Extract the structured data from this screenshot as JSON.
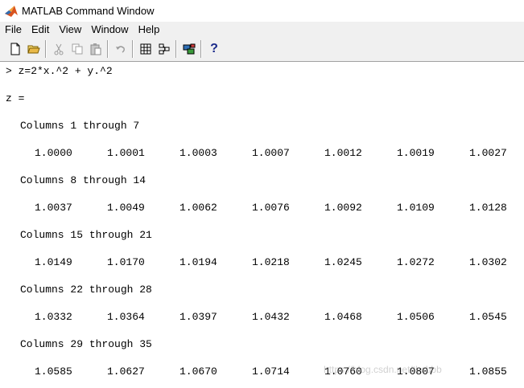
{
  "window": {
    "title": "MATLAB Command Window",
    "logo_icon": "matlab-logo-icon"
  },
  "menu": [
    "File",
    "Edit",
    "View",
    "Window",
    "Help"
  ],
  "toolbar": {
    "buttons": [
      "new-file-icon",
      "open-folder-icon",
      "cut-icon",
      "copy-icon",
      "paste-icon",
      "undo-icon",
      "workspace-icon",
      "path-browser-icon",
      "simulink-icon",
      "help-icon"
    ],
    "help_label": "?"
  },
  "console": {
    "command": "> z=2*x.^2 + y.^2",
    "var_label": "z =",
    "blocks": [
      {
        "header": "Columns 1 through 7",
        "values": [
          "1.0000",
          "1.0001",
          "1.0003",
          "1.0007",
          "1.0012",
          "1.0019",
          "1.0027"
        ]
      },
      {
        "header": "Columns 8 through 14",
        "values": [
          "1.0037",
          "1.0049",
          "1.0062",
          "1.0076",
          "1.0092",
          "1.0109",
          "1.0128"
        ]
      },
      {
        "header": "Columns 15 through 21",
        "values": [
          "1.0149",
          "1.0170",
          "1.0194",
          "1.0218",
          "1.0245",
          "1.0272",
          "1.0302"
        ]
      },
      {
        "header": "Columns 22 through 28",
        "values": [
          "1.0332",
          "1.0364",
          "1.0397",
          "1.0432",
          "1.0468",
          "1.0506",
          "1.0545"
        ]
      },
      {
        "header": "Columns 29 through 35",
        "values": [
          "1.0585",
          "1.0627",
          "1.0670",
          "1.0714",
          "1.0760",
          "1.0807",
          "1.0855"
        ]
      }
    ]
  },
  "watermark": "https://blog.csdn.net/tbcbbb"
}
